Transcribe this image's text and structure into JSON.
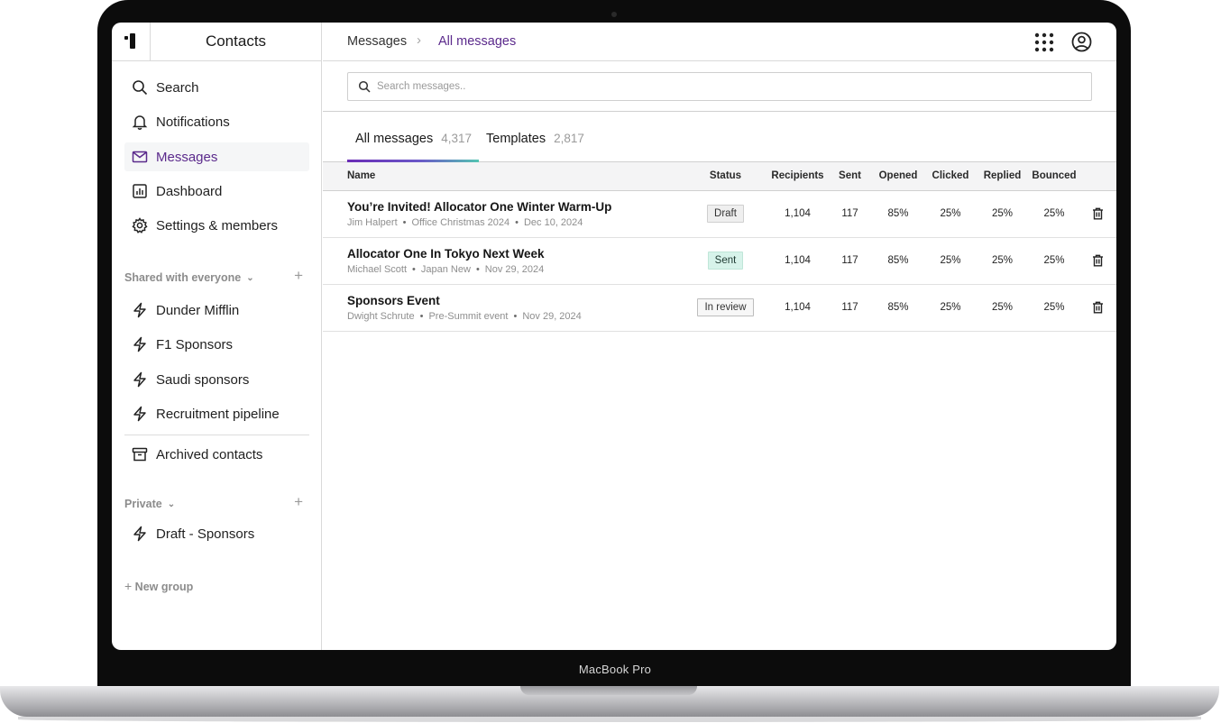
{
  "device": {
    "label": "MacBook Pro"
  },
  "sidebar": {
    "title": "Contacts",
    "nav": [
      {
        "label": "Search",
        "icon": "search-icon"
      },
      {
        "label": "Notifications",
        "icon": "bell-icon"
      },
      {
        "label": "Messages",
        "icon": "mail-icon",
        "active": true
      },
      {
        "label": "Dashboard",
        "icon": "chart-icon"
      },
      {
        "label": "Settings & members",
        "icon": "gear-icon"
      }
    ],
    "shared": {
      "heading": "Shared with everyone",
      "groups": [
        "Dunder Mifflin",
        "F1 Sponsors",
        "Saudi sponsors",
        "Recruitment pipeline"
      ]
    },
    "archived": "Archived contacts",
    "private": {
      "heading": "Private",
      "groups": [
        "Draft - Sponsors"
      ]
    },
    "new_group": "New group"
  },
  "header": {
    "breadcrumb_root": "Messages",
    "breadcrumb_current": "All messages"
  },
  "search": {
    "placeholder": "Search messages.."
  },
  "tabs": [
    {
      "label": "All messages",
      "count": "4,317",
      "active": true
    },
    {
      "label": "Templates",
      "count": "2,817"
    }
  ],
  "table": {
    "columns": [
      "Name",
      "Status",
      "Recipients",
      "Sent",
      "Opened",
      "Clicked",
      "Replied",
      "Bounced"
    ],
    "rows": [
      {
        "title": "You’re Invited! Allocator One Winter Warm-Up",
        "author": "Jim Halpert",
        "group": "Office Christmas 2024",
        "date": "Dec 10, 2024",
        "status": "Draft",
        "recipients": "1,104",
        "sent": "117",
        "opened": "85%",
        "clicked": "25%",
        "replied": "25%",
        "bounced": "25%"
      },
      {
        "title": "Allocator One In Tokyo Next Week",
        "author": "Michael Scott",
        "group": "Japan New",
        "date": "Nov 29, 2024",
        "status": "Sent",
        "recipients": "1,104",
        "sent": "117",
        "opened": "85%",
        "clicked": "25%",
        "replied": "25%",
        "bounced": "25%"
      },
      {
        "title": "Sponsors Event",
        "author": "Dwight Schrute",
        "group": "Pre-Summit event",
        "date": "Nov 29, 2024",
        "status": "In review",
        "recipients": "1,104",
        "sent": "117",
        "opened": "85%",
        "clicked": "25%",
        "replied": "25%",
        "bounced": "25%"
      }
    ]
  }
}
